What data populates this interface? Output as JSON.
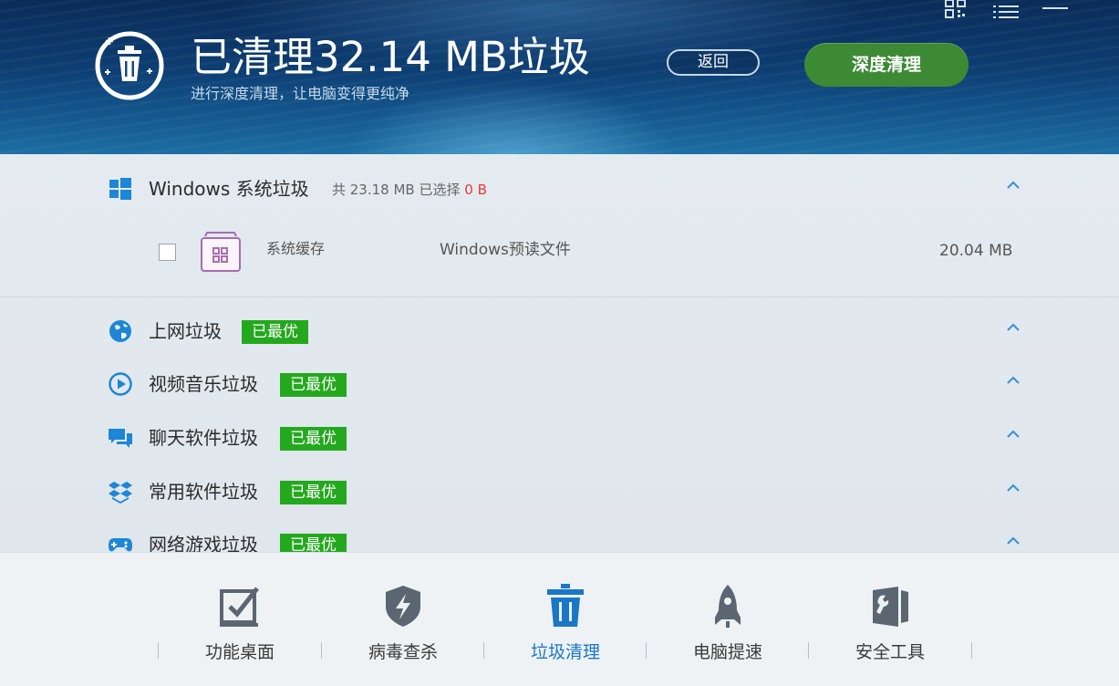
{
  "header": {
    "title": "已清理32.14 MB垃圾",
    "subtitle": "进行深度清理，让电脑变得更纯净",
    "back_label": "返回",
    "deep_clean_label": "深度清理"
  },
  "window_controls": [
    "qr-code-icon",
    "menu-icon",
    "minimize-icon"
  ],
  "windows_section": {
    "name": "Windows 系统垃圾",
    "meta_prefix": "共 23.18 MB 已选择",
    "selected": "0 B",
    "items": [
      {
        "name": "系统缓存",
        "desc": "Windows预读文件",
        "size": "20.04 MB",
        "checked": false
      }
    ]
  },
  "categories": [
    {
      "name": "上网垃圾",
      "badge": "已最优",
      "icon": "globe-icon"
    },
    {
      "name": "视频音乐垃圾",
      "badge": "已最优",
      "icon": "play-icon"
    },
    {
      "name": "聊天软件垃圾",
      "badge": "已最优",
      "icon": "chat-icon"
    },
    {
      "name": "常用软件垃圾",
      "badge": "已最优",
      "icon": "box-icon"
    },
    {
      "name": "网络游戏垃圾",
      "badge": "已最优",
      "icon": "gamepad-icon"
    }
  ],
  "nav": [
    {
      "label": "功能桌面",
      "icon": "checkbox-desk-icon",
      "active": false
    },
    {
      "label": "病毒查杀",
      "icon": "shield-bolt-icon",
      "active": false
    },
    {
      "label": "垃圾清理",
      "icon": "trash-icon",
      "active": true
    },
    {
      "label": "电脑提速",
      "icon": "rocket-icon",
      "active": false
    },
    {
      "label": "安全工具",
      "icon": "toolbox-icon",
      "active": false
    }
  ],
  "colors": {
    "accent_blue": "#1a77c7",
    "badge_green": "#24a81e",
    "deep_clean_green": "#3d8a35",
    "selected_red": "#e53a2e"
  }
}
